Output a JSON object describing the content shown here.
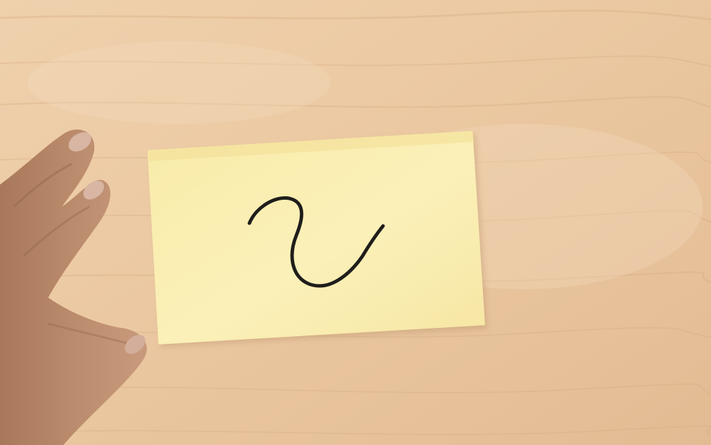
{
  "scene": {
    "subject": "sticky-note-with-squiggle",
    "colors": {
      "wood_light": "#f0d2ae",
      "wood_mid": "#e8c49c",
      "wood_dark": "#dcb38a",
      "grain": "#d9ad82",
      "note": "#f7e9a9",
      "note_light": "#fbf1bd",
      "note_shadow": "#d8b98d",
      "ink": "#1f1d1b",
      "skin": "#b98a6c",
      "skin_shadow": "#8f644b",
      "nail": "#d9b8a6"
    },
    "objects": [
      "wooden-table",
      "sticky-note",
      "ink-squiggle",
      "hand"
    ]
  }
}
